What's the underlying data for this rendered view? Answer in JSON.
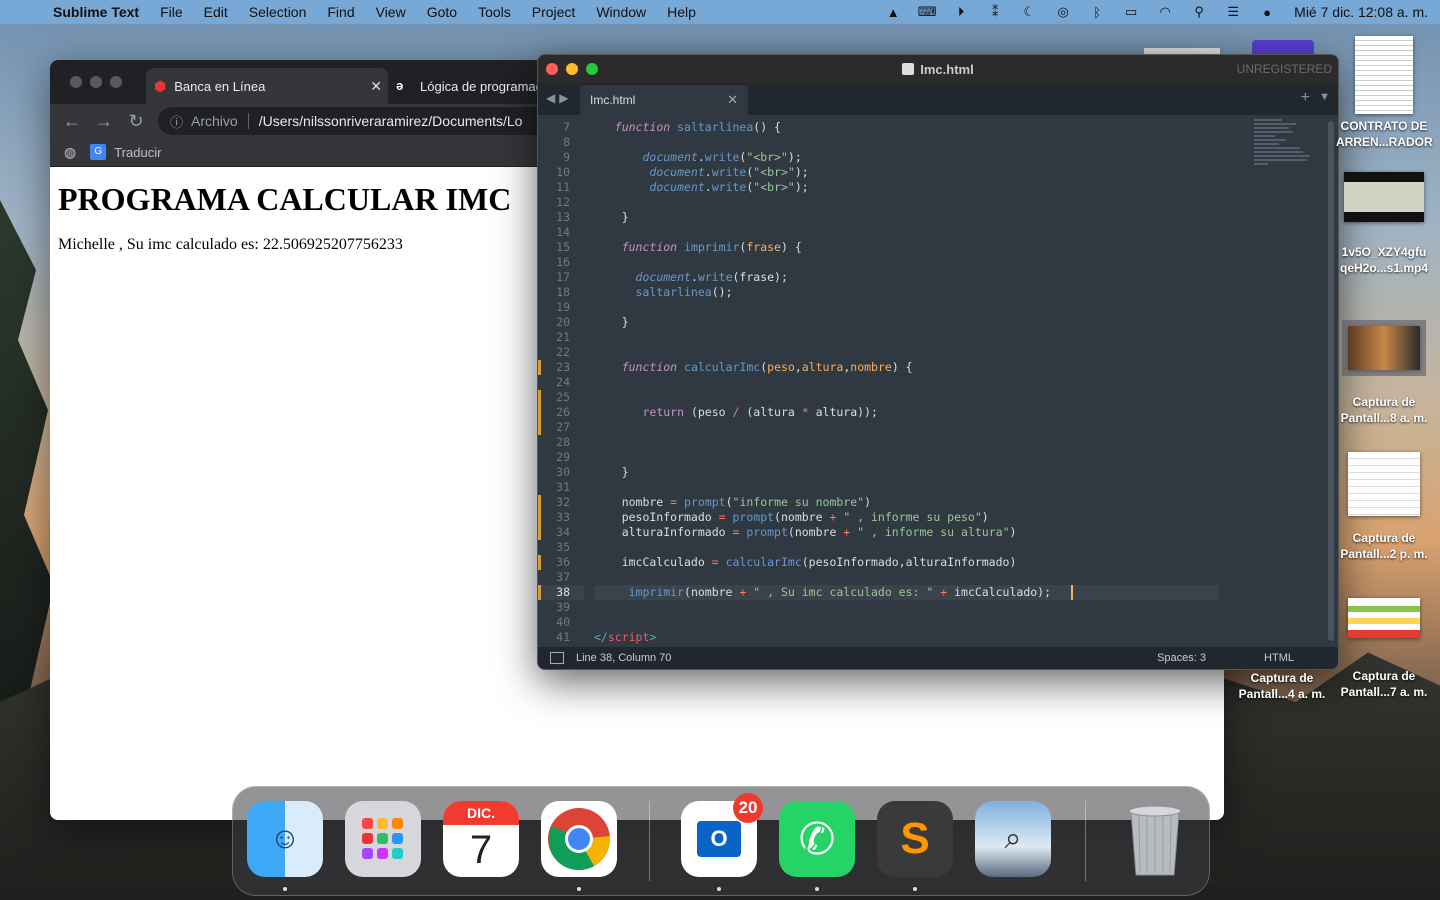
{
  "menubar": {
    "app_name": "Sublime Text",
    "items": [
      "File",
      "Edit",
      "Selection",
      "Find",
      "View",
      "Goto",
      "Tools",
      "Project",
      "Window",
      "Help"
    ],
    "clock": "Mié 7 dic.  12:08 a. m."
  },
  "chrome": {
    "tabs": [
      {
        "label": "Banca en Línea"
      },
      {
        "label": "Lógica de programació"
      }
    ],
    "omnibox": {
      "scheme_label": "Archivo",
      "url": "/Users/nilssonriveraramirez/Documents/Lo"
    },
    "bookmarks": {
      "translate_label": "Traducir"
    },
    "page": {
      "heading": "PROGRAMA CALCULAR IMC",
      "result_text": "Michelle , Su imc calculado es: 22.506925207756233"
    }
  },
  "sublime": {
    "title": "Imc.html",
    "unregistered": "UNREGISTERED",
    "tab_label": "Imc.html",
    "line_numbers": [
      7,
      8,
      9,
      10,
      11,
      12,
      13,
      14,
      15,
      16,
      17,
      18,
      19,
      20,
      21,
      22,
      23,
      24,
      25,
      26,
      27,
      28,
      29,
      30,
      31,
      32,
      33,
      34,
      35,
      36,
      37,
      38,
      39,
      40,
      41
    ],
    "current_line": 38,
    "modified_lines": [
      23,
      25,
      26,
      27,
      32,
      33,
      34,
      36,
      38
    ],
    "status": {
      "position": "Line 38, Column 70",
      "spaces": "Spaces: 3",
      "syntax": "HTML"
    }
  },
  "desktop": {
    "icons": [
      {
        "label1": "CONTRATO DE",
        "label2": "ARREN...RADOR"
      },
      {
        "label1": "1v5O_XZY4gfu",
        "label2": "qeH2o...s1.mp4"
      },
      {
        "label1": "Captura de",
        "label2": "Pantall...8 a. m."
      },
      {
        "label1": "Captura de",
        "label2": "Pantall...2 p. m."
      },
      {
        "label1": "Captura de",
        "label2": "Pantall...4 a. m."
      },
      {
        "label1": "Captura de",
        "label2": "Pantall...7 a. m."
      }
    ]
  },
  "dock": {
    "calendar_month": "DIC.",
    "calendar_day": "7",
    "outlook_badge": "20"
  },
  "colors": {
    "accent_red": "#ff5f57",
    "accent_yellow": "#febc2e",
    "accent_green": "#28c840",
    "cursor": "#f9ae58"
  }
}
